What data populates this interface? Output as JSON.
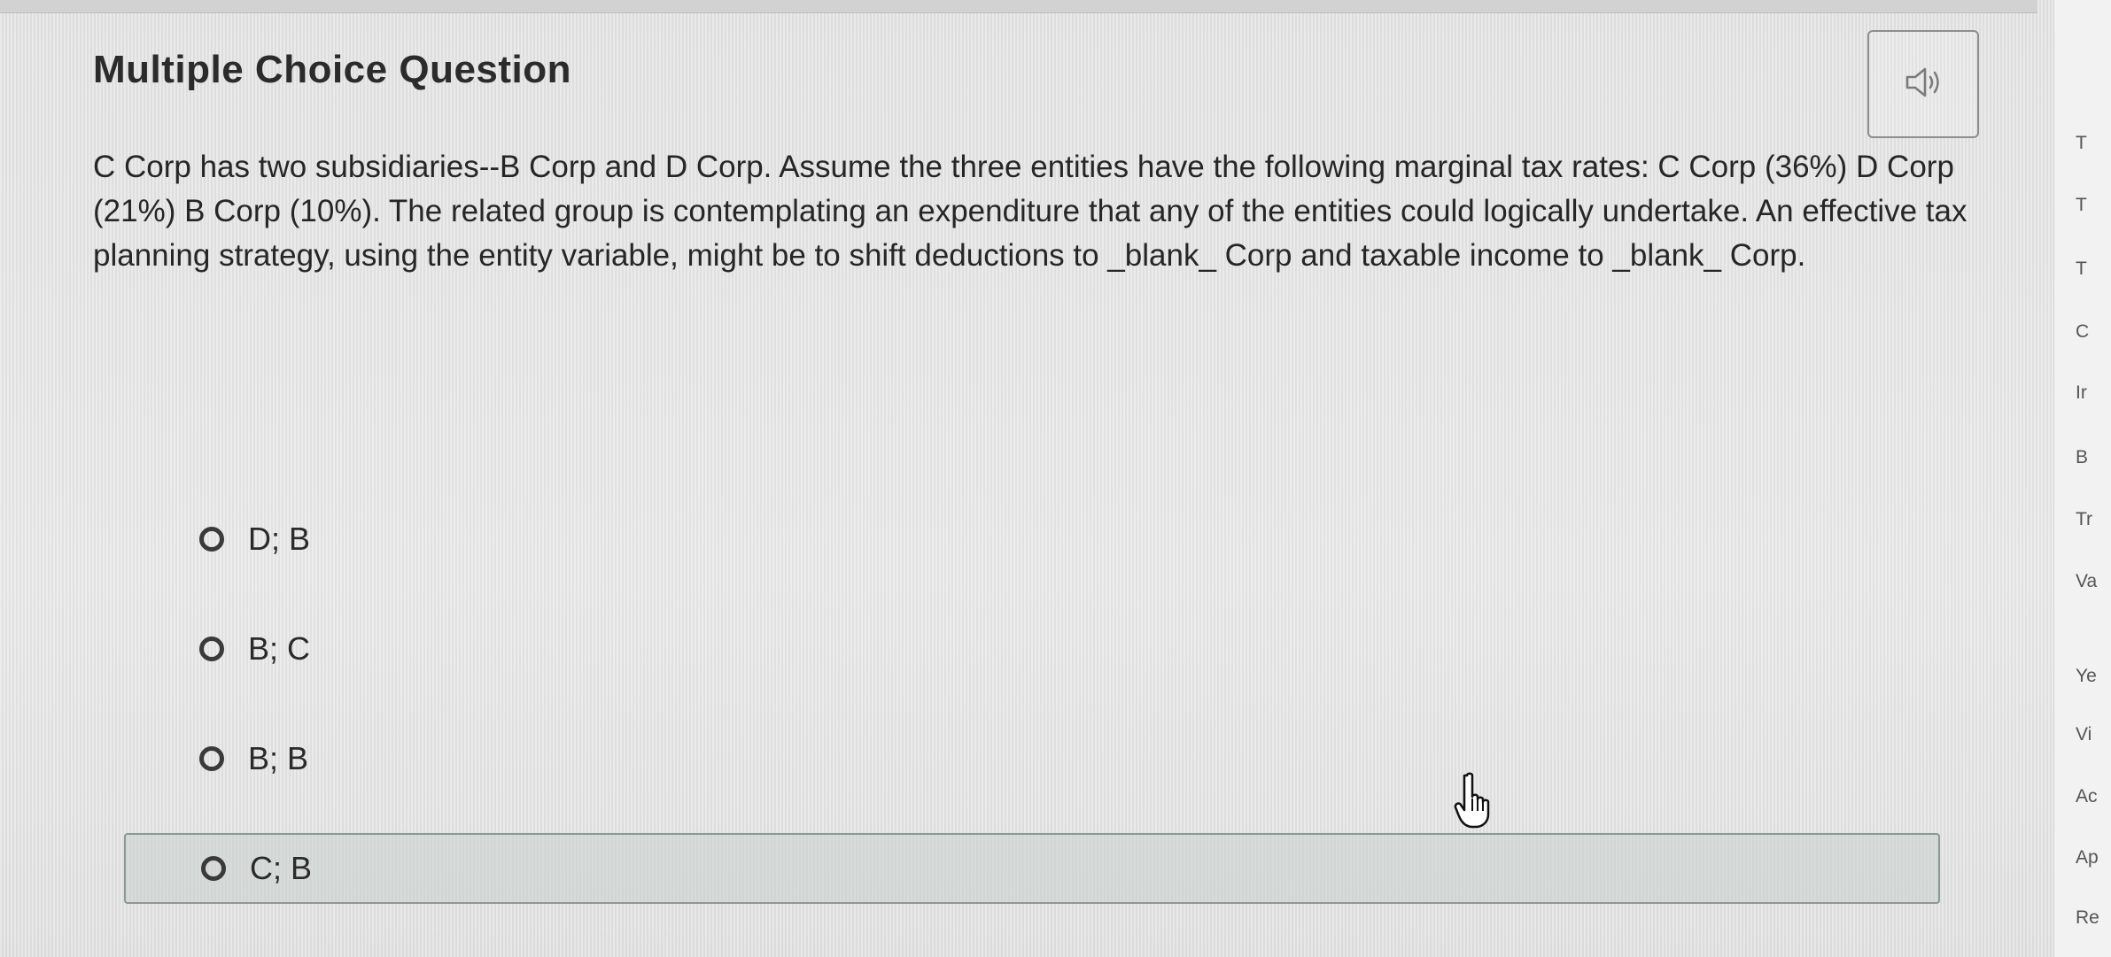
{
  "question": {
    "title": "Multiple Choice Question",
    "text": "C Corp has two subsidiaries--B Corp and D Corp. Assume the three entities have the following marginal tax rates: C Corp (36%) D Corp (21%) B Corp (10%). The related group is contemplating an expenditure that any of the entities could logically undertake. An effective tax planning strategy, using the entity variable, might be to shift deductions to _blank_ Corp and taxable income to _blank_ Corp.",
    "audio_icon": "speaker-icon"
  },
  "choices": [
    {
      "label": "D; B",
      "highlighted": false
    },
    {
      "label": "B; C",
      "highlighted": false
    },
    {
      "label": "B; B",
      "highlighted": false
    },
    {
      "label": "C; B",
      "highlighted": true
    }
  ],
  "sidebar": {
    "items": [
      "T",
      "T",
      "T",
      "C",
      "Ir",
      "B",
      "Tr",
      "Va",
      "Ye",
      "Vi",
      "Ac",
      "Ap",
      "Re"
    ]
  },
  "colors": {
    "background": "#e6e6e6",
    "text": "#262626",
    "highlight_border": "#8a9a95"
  },
  "cursor": "hand-pointer-icon"
}
